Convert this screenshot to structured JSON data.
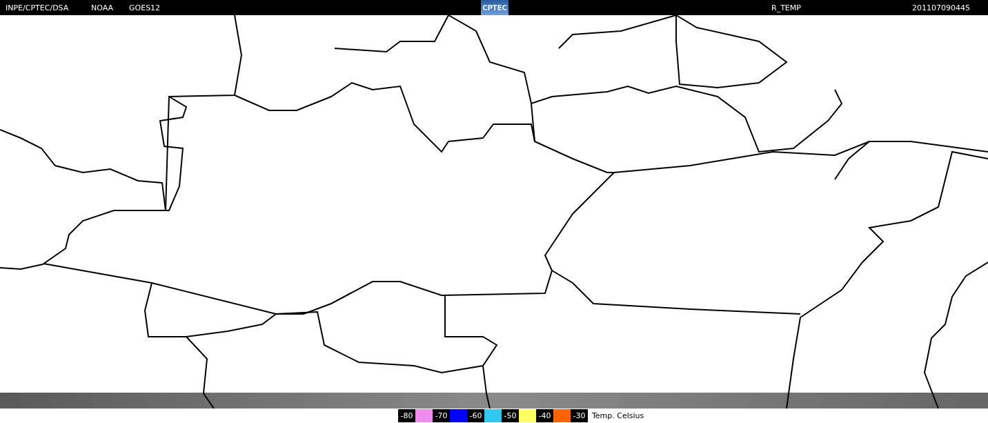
{
  "header": {
    "agency": "INPE/CPTEC/DSA",
    "provider": "NOAA",
    "satellite": "GOES12",
    "logo": "CPTEC",
    "product": "R_TEMP",
    "timestamp": "201107090445"
  },
  "legend": {
    "ticks": [
      "-80",
      "-70",
      "-60",
      "-50",
      "-40",
      "-30"
    ],
    "swatches": [
      {
        "color": "#f08cf0"
      },
      {
        "color": "#0000ff"
      },
      {
        "color": "#30c8f0"
      },
      {
        "color": "#ffff64"
      },
      {
        "color": "#ff6400"
      }
    ],
    "title": "Temp. Celsius"
  }
}
